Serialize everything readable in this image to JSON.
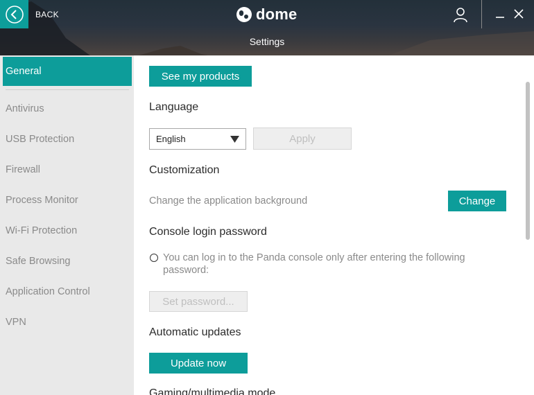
{
  "header": {
    "back_label": "BACK",
    "logo_text": "dome",
    "title": "Settings"
  },
  "sidebar": {
    "items": [
      {
        "label": "General",
        "active": true
      },
      {
        "label": "Antivirus",
        "active": false
      },
      {
        "label": "USB Protection",
        "active": false
      },
      {
        "label": "Firewall",
        "active": false
      },
      {
        "label": "Process Monitor",
        "active": false
      },
      {
        "label": "Wi-Fi Protection",
        "active": false
      },
      {
        "label": "Safe Browsing",
        "active": false
      },
      {
        "label": "Application Control",
        "active": false
      },
      {
        "label": "VPN",
        "active": false
      }
    ]
  },
  "general": {
    "see_products_label": "See my products",
    "language": {
      "title": "Language",
      "selected": "English",
      "apply_label": "Apply"
    },
    "customization": {
      "title": "Customization",
      "description": "Change the application background",
      "change_label": "Change"
    },
    "console_password": {
      "title": "Console login password",
      "option_text": "You can log in to the Panda console only after entering the following password:",
      "checked": false,
      "set_password_label": "Set password..."
    },
    "automatic_updates": {
      "title": "Automatic updates",
      "update_label": "Update now"
    },
    "gaming": {
      "title": "Gaming/multimedia mode"
    }
  },
  "colors": {
    "accent": "#0d9d9a",
    "sidebar_bg": "#e9e9e9",
    "muted_text": "#8a8a8a"
  }
}
